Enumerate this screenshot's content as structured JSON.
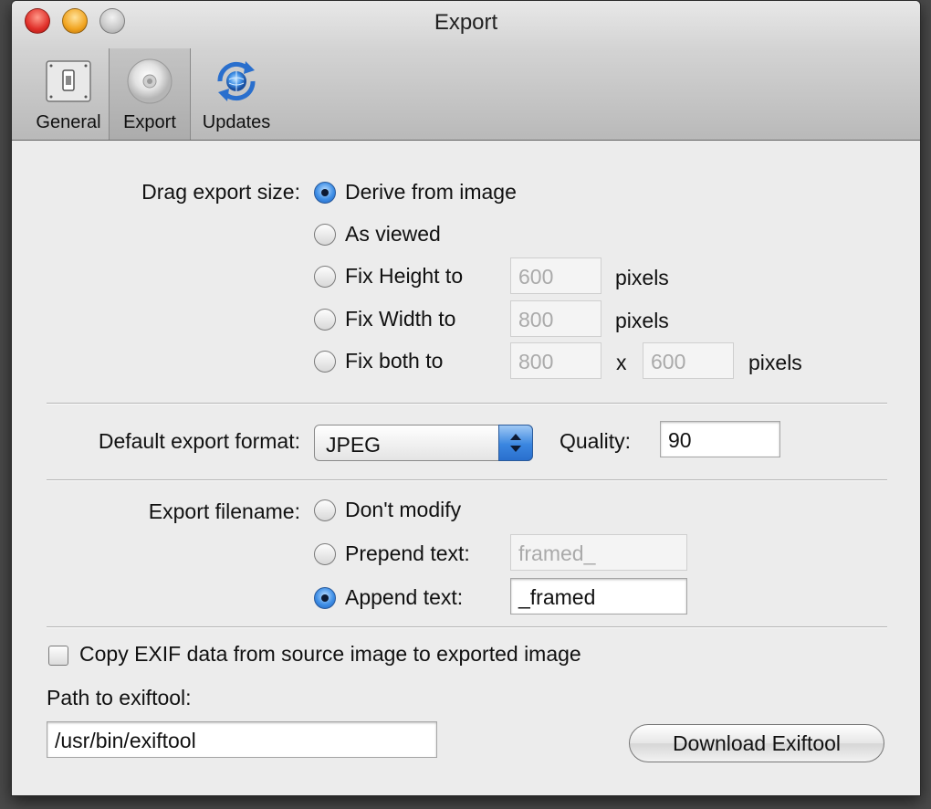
{
  "window": {
    "title": "Export"
  },
  "toolbar": {
    "items": [
      {
        "label": "General",
        "icon": "switch-icon"
      },
      {
        "label": "Export",
        "icon": "disc-icon",
        "selected": true
      },
      {
        "label": "Updates",
        "icon": "sync-globe-icon"
      }
    ]
  },
  "drag_export": {
    "label": "Drag export size:",
    "options": [
      "Derive from image",
      "As viewed",
      "Fix Height to",
      "Fix Width to",
      "Fix both to"
    ],
    "selected": "Derive from image",
    "fix_height_value": "600",
    "fix_width_value": "800",
    "fix_both_width_value": "800",
    "fix_both_height_value": "600",
    "times": "x",
    "unit": "pixels"
  },
  "format": {
    "label": "Default export format:",
    "selected": "JPEG",
    "quality_label": "Quality:",
    "quality_value": "90"
  },
  "filename": {
    "label": "Export filename:",
    "options": [
      "Don't modify",
      "Prepend text:",
      "Append text:"
    ],
    "selected": "Append text:",
    "prepend_value": "framed_",
    "append_value": "_framed"
  },
  "exif": {
    "checkbox_label": "Copy EXIF data from source image to exported image",
    "checked": false,
    "path_label": "Path to exiftool:",
    "path_value": "/usr/bin/exiftool",
    "download_button": "Download Exiftool"
  },
  "colors": {
    "accent": "#3a86e0",
    "close": "#e0302a",
    "minimize": "#f1a420"
  }
}
